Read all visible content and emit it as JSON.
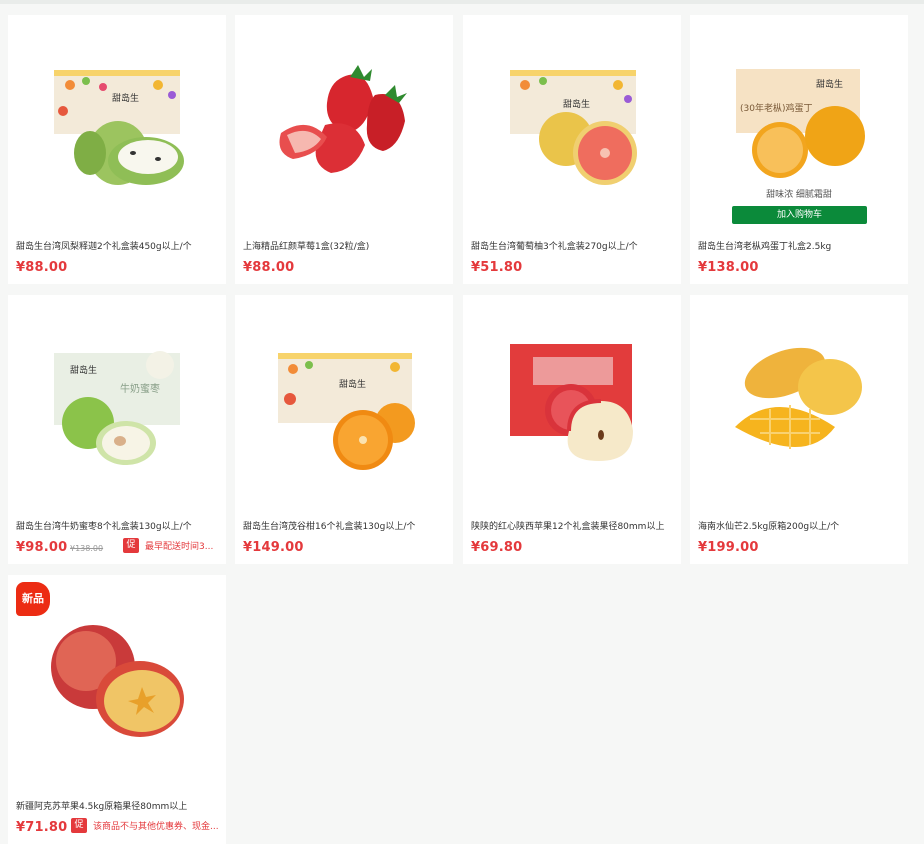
{
  "colors": {
    "price": "#e4393c",
    "cart_button": "#0b8a3a",
    "new_badge": "#ec2c13"
  },
  "products": [
    {
      "title": "甜岛生台湾凤梨释迦2个礼盒装450g以上/个",
      "price": "¥88.00",
      "image": "custard-apple-gift-box"
    },
    {
      "title": "上海精品红颜草莓1盒(32粒/盒)",
      "price": "¥88.00",
      "image": "strawberries"
    },
    {
      "title": "甜岛生台湾葡萄柚3个礼盒装270g以上/个",
      "price": "¥51.80",
      "image": "grapefruit-gift-box"
    },
    {
      "title": "甜岛生台湾老枞鸡蛋丁礼盒2.5kg",
      "price": "¥138.00",
      "image": "orange-gift-box",
      "hover_subtitle": "甜味浓 细腻霜甜",
      "cart_button": "加入购物车",
      "box_text": "(30年老枞)鸡蛋丁"
    },
    {
      "title": "甜岛生台湾牛奶蜜枣8个礼盒装130g以上/个",
      "price": "¥98.00",
      "old_price": "¥138.00",
      "promo_tag": "促",
      "promo_text": "最早配送时间3...",
      "image": "milk-jujube-gift-box",
      "box_text": "牛奶蜜枣"
    },
    {
      "title": "甜岛生台湾茂谷柑16个礼盒装130g以上/个",
      "price": "¥149.00",
      "image": "murcott-gift-box"
    },
    {
      "title": "陕陕的红心陕西苹果12个礼盒装果径80mm以上",
      "price": "¥69.80",
      "image": "apple-red-box"
    },
    {
      "title": "海南水仙芒2.5kg原箱200g以上/个",
      "price": "¥199.00",
      "image": "mango"
    },
    {
      "title": "新疆阿克苏苹果4.5kg原箱果径80mm以上",
      "price": "¥71.80",
      "badge": "新品",
      "promo_tag": "促",
      "promo_text": "该商品不与其他优惠券、现金...",
      "image": "aksu-apple"
    }
  ]
}
